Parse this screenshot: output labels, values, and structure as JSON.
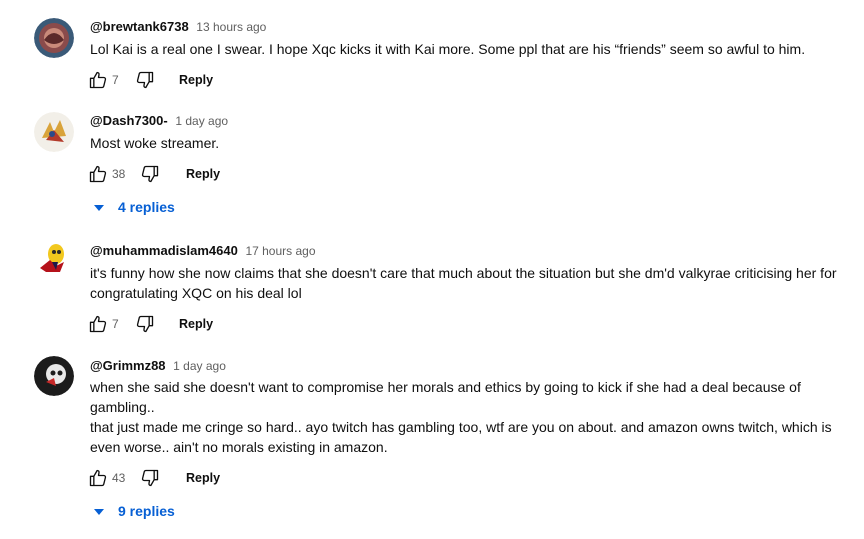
{
  "comments": [
    {
      "author": "@brewtank6738",
      "time": "13 hours ago",
      "lines": [
        "Lol Kai is a real one I swear. I hope Xqc kicks it with Kai more. Some ppl that are his “friends” seem so awful to him."
      ],
      "likes": "7",
      "reply_label": "Reply"
    },
    {
      "author": "@Dash7300-",
      "time": "1 day ago",
      "lines": [
        "Most woke streamer."
      ],
      "likes": "38",
      "reply_label": "Reply",
      "replies_label": "4 replies"
    },
    {
      "author": "@muhammadislam4640",
      "time": "17 hours ago",
      "lines": [
        "it's funny how she now claims that she doesn't care that much about the situation but she dm'd valkyrae criticising her for",
        "congratulating XQC on his deal lol"
      ],
      "likes": "7",
      "reply_label": "Reply"
    },
    {
      "author": "@Grimmz88",
      "time": "1 day ago",
      "lines": [
        "when she said she doesn't want to compromise her morals and ethics by going to kick if she had a deal because of",
        "gambling..",
        "that just made me cringe so hard.. ayo twitch has gambling too, wtf are you on about. and amazon owns twitch, which is",
        "even worse.. ain't no morals existing in amazon."
      ],
      "likes": "43",
      "reply_label": "Reply",
      "replies_label": "9 replies"
    }
  ],
  "icons": {
    "like": "thumbs-up-icon",
    "dislike": "thumbs-down-icon",
    "expand": "caret-down-icon"
  },
  "colors": {
    "link": "#065fd4",
    "secondary_text": "#606060",
    "primary_text": "#0f0f0f"
  }
}
